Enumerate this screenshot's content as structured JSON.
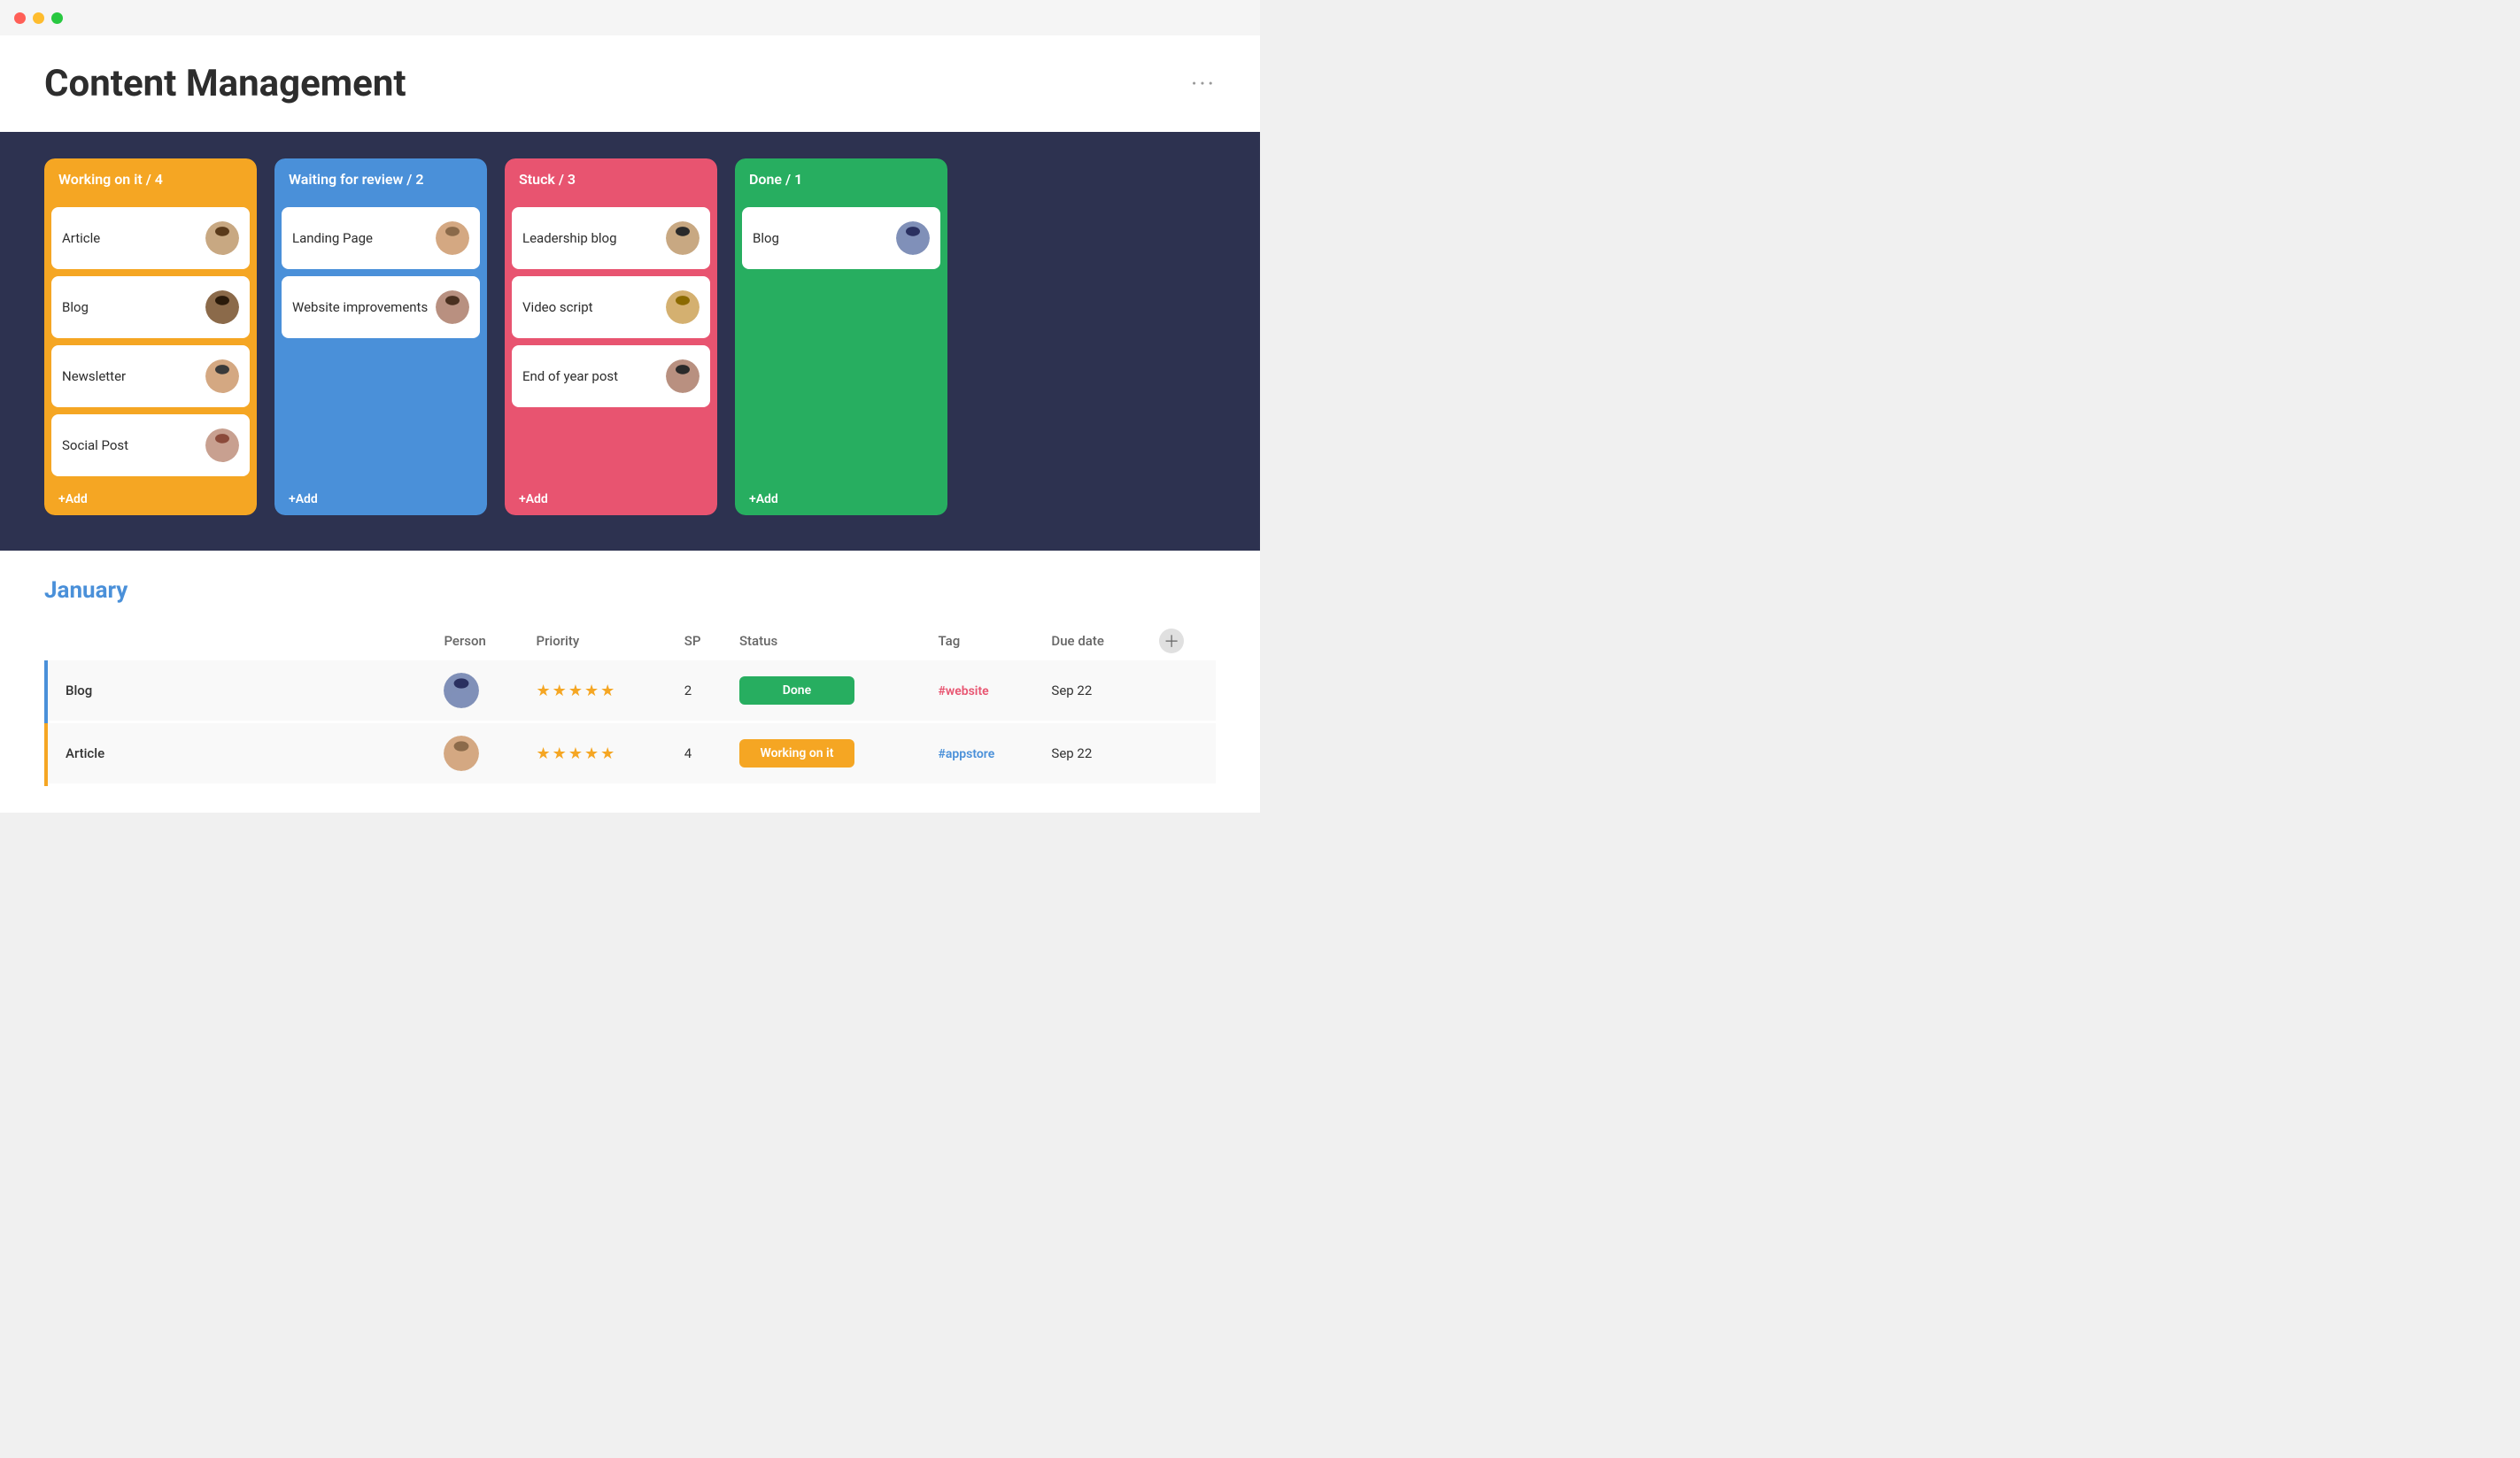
{
  "titleBar": {
    "lights": [
      "red",
      "yellow",
      "green"
    ]
  },
  "header": {
    "title": "Content Management",
    "moreDots": "···"
  },
  "kanban": {
    "columns": [
      {
        "id": "working",
        "header": "Working on it / 4",
        "colorClass": "col-working",
        "cards": [
          {
            "title": "Article",
            "avatar": "person1"
          },
          {
            "title": "Blog",
            "avatar": "person2"
          },
          {
            "title": "Newsletter",
            "avatar": "person3"
          },
          {
            "title": "Social Post",
            "avatar": "person4"
          }
        ],
        "addLabel": "+Add"
      },
      {
        "id": "waiting",
        "header": "Waiting for review / 2",
        "colorClass": "col-waiting",
        "cards": [
          {
            "title": "Landing Page",
            "avatar": "person5"
          },
          {
            "title": "Website improvements",
            "avatar": "person6"
          }
        ],
        "addLabel": "+Add"
      },
      {
        "id": "stuck",
        "header": "Stuck / 3",
        "colorClass": "col-stuck",
        "cards": [
          {
            "title": "Leadership blog",
            "avatar": "person7"
          },
          {
            "title": "Video script",
            "avatar": "person8"
          },
          {
            "title": "End of year post",
            "avatar": "person9"
          }
        ],
        "addLabel": "+Add"
      },
      {
        "id": "done",
        "header": "Done / 1",
        "colorClass": "col-done",
        "cards": [
          {
            "title": "Blog",
            "avatar": "person10"
          }
        ],
        "addLabel": "+Add"
      }
    ]
  },
  "table": {
    "month": "January",
    "columns": [
      "Person",
      "Priority",
      "SP",
      "Status",
      "Tag",
      "Due date"
    ],
    "rows": [
      {
        "name": "Blog",
        "person": "person10",
        "priority": "★★★★★",
        "sp": "2",
        "status": "Done",
        "statusClass": "status-done",
        "tag": "#website",
        "tagClass": "tag-link",
        "dueDate": "Sep 22"
      },
      {
        "name": "Article",
        "person": "person11",
        "priority": "★★★★★",
        "sp": "4",
        "status": "Working on it",
        "statusClass": "status-working",
        "tag": "#appstore",
        "tagClass": "tag-appstore",
        "dueDate": "Sep 22"
      }
    ]
  }
}
